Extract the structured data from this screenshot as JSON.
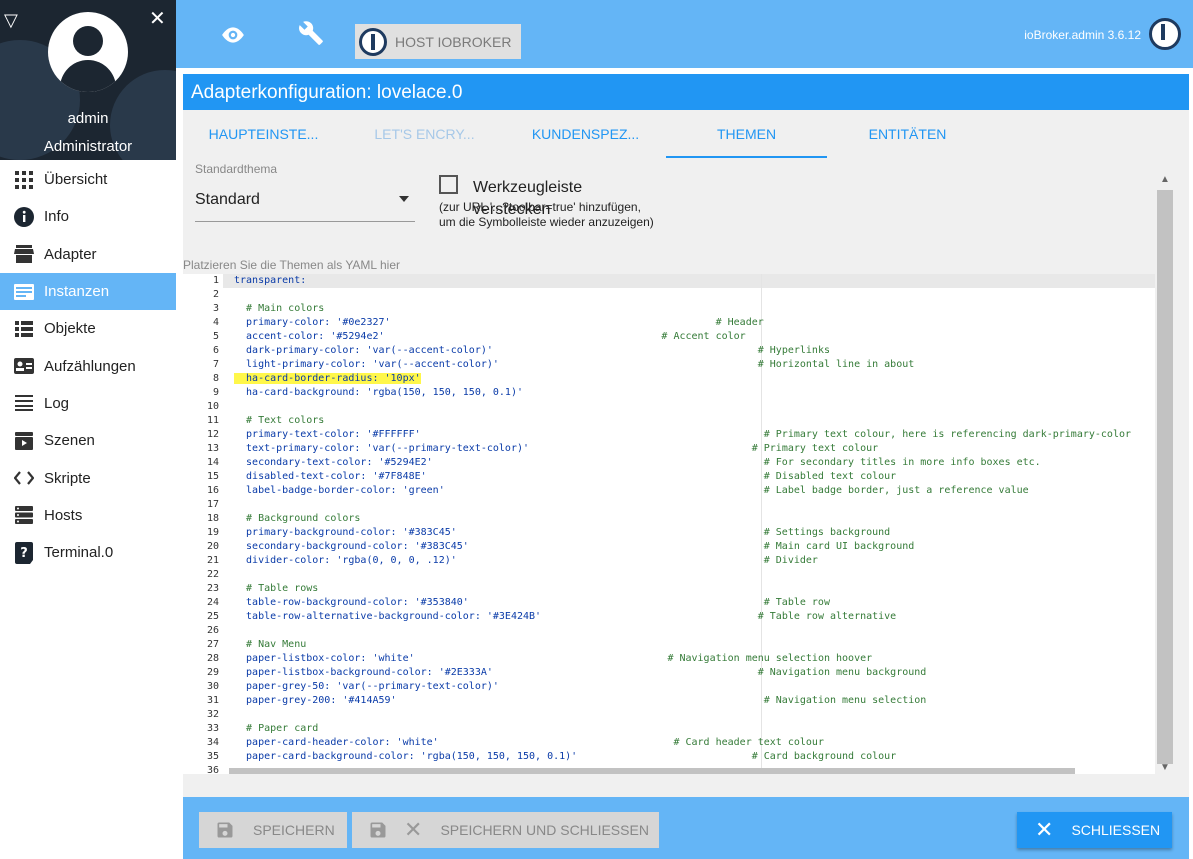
{
  "sidebar": {
    "user_name": "admin",
    "user_role": "Administrator",
    "items": [
      {
        "label": "Übersicht",
        "icon": "grid-icon",
        "active": false
      },
      {
        "label": "Info",
        "icon": "info-icon",
        "active": false
      },
      {
        "label": "Adapter",
        "icon": "store-icon",
        "active": false
      },
      {
        "label": "Instanzen",
        "icon": "instances-icon",
        "active": true
      },
      {
        "label": "Objekte",
        "icon": "list-icon",
        "active": false
      },
      {
        "label": "Aufzählungen",
        "icon": "enum-icon",
        "active": false
      },
      {
        "label": "Log",
        "icon": "log-icon",
        "active": false
      },
      {
        "label": "Szenen",
        "icon": "scenes-icon",
        "active": false
      },
      {
        "label": "Skripte",
        "icon": "code-icon",
        "active": false
      },
      {
        "label": "Hosts",
        "icon": "hosts-icon",
        "active": false
      },
      {
        "label": "Terminal.0",
        "icon": "terminal-icon",
        "active": false
      }
    ]
  },
  "topbar": {
    "host_label": "HOST IOBROKER",
    "version": "ioBroker.admin 3.6.12"
  },
  "dialog": {
    "title": "Adapterkonfiguration: lovelace.0",
    "tabs": [
      {
        "label": "HAUPTEINSTE...",
        "state": "normal"
      },
      {
        "label": "LET'S ENCRY...",
        "state": "disabled"
      },
      {
        "label": "KUNDENSPEZ...",
        "state": "normal"
      },
      {
        "label": "THEMEN",
        "state": "active"
      },
      {
        "label": "ENTITÄTEN",
        "state": "normal"
      }
    ],
    "theme_label": "Standardthema",
    "theme_value": "Standard",
    "toolbar_label": "Werkzeugleiste verstecken",
    "toolbar_hint": "(zur URL '...?toolbar=true' hinzufügen, um die Symbolleiste wieder anzuzeigen)",
    "yaml_label": "Platzieren Sie die Themen als YAML hier"
  },
  "editor": {
    "lines": [
      {
        "n": "1",
        "code": "transparent:",
        "comment": "",
        "ci": 0
      },
      {
        "n": "2",
        "code": "",
        "comment": "",
        "ci": 0
      },
      {
        "n": "3",
        "code": "",
        "comment": "  # Main colors",
        "ci": 0
      },
      {
        "n": "4",
        "code": "  primary-color: '#0e2327'",
        "comment": "# Header",
        "ci": 80
      },
      {
        "n": "5",
        "code": "  accent-color: '#5294e2'",
        "comment": "# Accent color",
        "ci": 71
      },
      {
        "n": "6",
        "code": "  dark-primary-color: 'var(--accent-color)'",
        "comment": "# Hyperlinks",
        "ci": 87
      },
      {
        "n": "7",
        "code": "  light-primary-color: 'var(--accent-color)'",
        "comment": "# Horizontal line in about",
        "ci": 87
      },
      {
        "n": "8",
        "code": "  ha-card-border-radius: '10px'",
        "comment": "",
        "ci": 0,
        "highlight": true
      },
      {
        "n": "9",
        "code": "  ha-card-background: 'rgba(150, 150, 150, 0.1)'",
        "comment": "",
        "ci": 0
      },
      {
        "n": "10",
        "code": "",
        "comment": "",
        "ci": 0
      },
      {
        "n": "11",
        "code": "",
        "comment": "  # Text colors",
        "ci": 0
      },
      {
        "n": "12",
        "code": "  primary-text-color: '#FFFFFF'",
        "comment": "# Primary text colour, here is referencing dark-primary-color",
        "ci": 88
      },
      {
        "n": "13",
        "code": "  text-primary-color: 'var(--primary-text-color)'",
        "comment": "# Primary text colour",
        "ci": 86
      },
      {
        "n": "14",
        "code": "  secondary-text-color: '#5294E2'",
        "comment": "# For secondary titles in more info boxes etc.",
        "ci": 88
      },
      {
        "n": "15",
        "code": "  disabled-text-color: '#7F848E'",
        "comment": "# Disabled text colour",
        "ci": 88
      },
      {
        "n": "16",
        "code": "  label-badge-border-color: 'green'",
        "comment": "# Label badge border, just a reference value",
        "ci": 88
      },
      {
        "n": "17",
        "code": "",
        "comment": "",
        "ci": 0
      },
      {
        "n": "18",
        "code": "",
        "comment": "  # Background colors",
        "ci": 0
      },
      {
        "n": "19",
        "code": "  primary-background-color: '#383C45'",
        "comment": "# Settings background",
        "ci": 88
      },
      {
        "n": "20",
        "code": "  secondary-background-color: '#383C45'",
        "comment": "# Main card UI background",
        "ci": 88
      },
      {
        "n": "21",
        "code": "  divider-color: 'rgba(0, 0, 0, .12)'",
        "comment": "# Divider",
        "ci": 88
      },
      {
        "n": "22",
        "code": "",
        "comment": "",
        "ci": 0
      },
      {
        "n": "23",
        "code": "",
        "comment": "  # Table rows",
        "ci": 0
      },
      {
        "n": "24",
        "code": "  table-row-background-color: '#353840'",
        "comment": "# Table row",
        "ci": 88
      },
      {
        "n": "25",
        "code": "  table-row-alternative-background-color: '#3E424B'",
        "comment": "# Table row alternative",
        "ci": 87
      },
      {
        "n": "26",
        "code": "",
        "comment": "",
        "ci": 0
      },
      {
        "n": "27",
        "code": "",
        "comment": "  # Nav Menu",
        "ci": 0
      },
      {
        "n": "28",
        "code": "  paper-listbox-color: 'white'",
        "comment": "# Navigation menu selection hoover",
        "ci": 72
      },
      {
        "n": "29",
        "code": "  paper-listbox-background-color: '#2E333A'",
        "comment": "# Navigation menu background",
        "ci": 87
      },
      {
        "n": "30",
        "code": "  paper-grey-50: 'var(--primary-text-color)'",
        "comment": "",
        "ci": 0
      },
      {
        "n": "31",
        "code": "  paper-grey-200: '#414A59'",
        "comment": "# Navigation menu selection",
        "ci": 88
      },
      {
        "n": "32",
        "code": "",
        "comment": "",
        "ci": 0
      },
      {
        "n": "33",
        "code": "",
        "comment": "  # Paper card",
        "ci": 0
      },
      {
        "n": "34",
        "code": "  paper-card-header-color: 'white'",
        "comment": "# Card header text colour",
        "ci": 73
      },
      {
        "n": "35",
        "code": "  paper-card-background-color: 'rgba(150, 150, 150, 0.1)'",
        "comment": "# Card background colour",
        "ci": 86
      },
      {
        "n": "36",
        "code": "",
        "comment": "",
        "ci": 0
      }
    ]
  },
  "footer": {
    "save_label": "SPEICHERN",
    "save_close_label": "SPEICHERN UND SCHLIESSEN",
    "close_label": "SCHLIESSEN"
  },
  "colors": {
    "accent": "#2196f3",
    "topbar": "#64b5f6",
    "highlight": "#fff74a"
  }
}
